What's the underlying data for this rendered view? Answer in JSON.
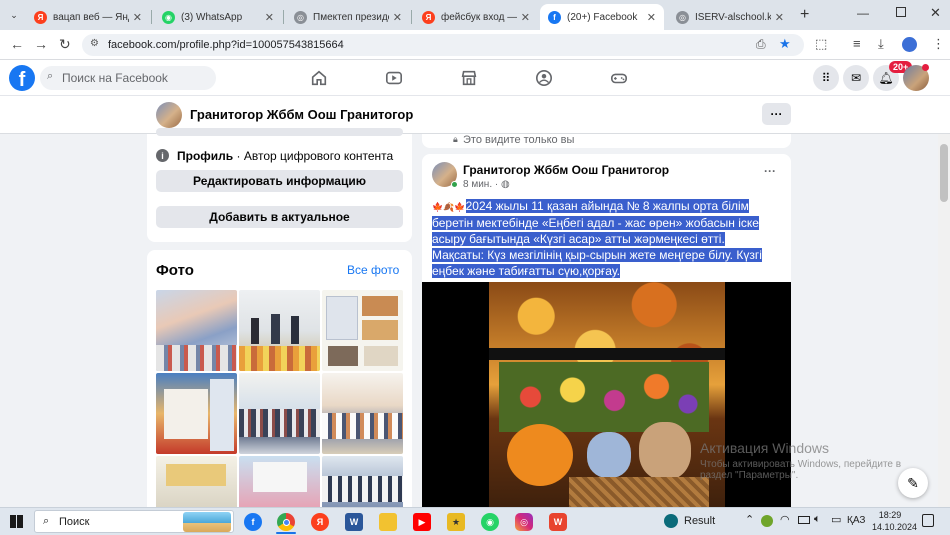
{
  "browser": {
    "tabs": [
      {
        "title": "вацап веб — Яндекс",
        "favicon": "yandex-icon",
        "color": "#f33"
      },
      {
        "title": "(3) WhatsApp",
        "favicon": "whatsapp-icon",
        "color": "#25d366"
      },
      {
        "title": "Пмектеп президентi",
        "favicon": "globe-icon",
        "color": "#777"
      },
      {
        "title": "фейсбук вход — Янд",
        "favicon": "yandex-icon",
        "color": "#f33"
      },
      {
        "title": "(20+) Facebook",
        "favicon": "facebook-icon",
        "color": "#1877f2"
      },
      {
        "title": "ISERV-alschool.kz - П",
        "favicon": "globe-icon",
        "color": "#777"
      }
    ],
    "new_tab": "+",
    "url": "facebook.com/profile.php?id=100057543815664"
  },
  "facebook": {
    "search_placeholder": "Поиск на Facebook",
    "notification_badge": "20+",
    "accent": "#1877f2"
  },
  "profile_bar": {
    "name": "Гранитогор Жббм Оош Гранитогор",
    "more": "···"
  },
  "intro": {
    "profile_label": "Профиль",
    "profile_desc": "· Автор цифрового контента",
    "edit_button": "Редактировать информацию",
    "featured_button": "Добавить в актуальное"
  },
  "photos": {
    "title": "Фото",
    "all_link": "Все фото"
  },
  "privacy_note": "Это видите только вы",
  "post": {
    "author": "Гранитогор Жббм Оош Гранитогор",
    "time": "8 мин. ·",
    "emoji": "🍁🍂🍁",
    "line1": "2024 жылы 11 қазан  айында  № 8 жалпы орта білім",
    "line2": "беретін мектебінде  «Еңбегі адал - жас өрен» жобасын іске",
    "line3": "асыру бағытында «Күзгі асар» атты жәрмеңкесі өтті.",
    "line4": "Мақсаты: Күз мезгілінің қыр-сырын жете меңгере білу. Күзгі",
    "line5": "еңбек және табиғатты сүю,қорғау.",
    "more": "···"
  },
  "watermark": {
    "title": "Активация Windows",
    "line1": "Чтобы активировать Windows, перейдите в",
    "line2": "раздел \"Параметры\"."
  },
  "taskbar": {
    "search": "Поиск",
    "result": "Result",
    "lang": "ҚАЗ",
    "time": "18:29",
    "date": "14.10.2024"
  }
}
